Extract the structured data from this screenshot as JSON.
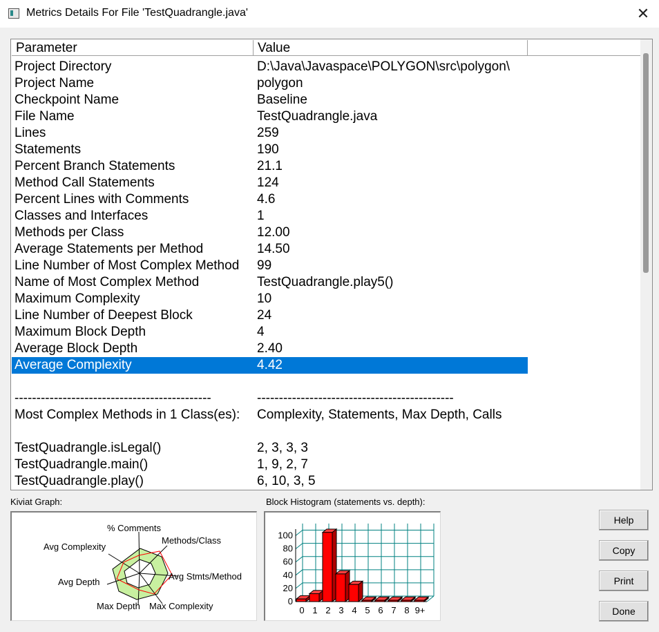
{
  "window": {
    "title": "Metrics Details For File 'TestQuadrangle.java'",
    "close_glyph": "✕"
  },
  "table": {
    "headers": [
      "Parameter",
      "Value"
    ],
    "rows": [
      [
        "Project Directory",
        "D:\\Java\\Javaspace\\POLYGON\\src\\polygon\\"
      ],
      [
        "Project Name",
        "polygon"
      ],
      [
        "Checkpoint Name",
        "Baseline"
      ],
      [
        "File Name",
        "TestQuadrangle.java"
      ],
      [
        "Lines",
        "259"
      ],
      [
        "Statements",
        "190"
      ],
      [
        "Percent Branch Statements",
        "21.1"
      ],
      [
        "Method Call Statements",
        "124"
      ],
      [
        "Percent Lines with Comments",
        "4.6"
      ],
      [
        "Classes and Interfaces",
        "1"
      ],
      [
        "Methods per Class",
        "12.00"
      ],
      [
        "Average Statements per Method",
        "14.50"
      ],
      [
        "Line Number of Most Complex Method",
        "99"
      ],
      [
        "Name of Most Complex Method",
        "TestQuadrangle.play5()"
      ],
      [
        "Maximum Complexity",
        "10"
      ],
      [
        "Line Number of Deepest Block",
        "24"
      ],
      [
        "Maximum Block Depth",
        "4"
      ],
      [
        "Average Block Depth",
        "2.40"
      ],
      [
        "Average Complexity",
        "4.42"
      ],
      [
        "",
        ""
      ],
      [
        "---------------------------------------------",
        "---------------------------------------------"
      ],
      [
        "Most Complex Methods in 1 Class(es):",
        "Complexity, Statements, Max Depth, Calls"
      ],
      [
        "",
        ""
      ],
      [
        "TestQuadrangle.isLegal()",
        "2, 3, 3, 3"
      ],
      [
        "TestQuadrangle.main()",
        "1, 9, 2, 7"
      ],
      [
        "TestQuadrangle.play()",
        "6, 10, 3, 5"
      ]
    ],
    "selected_row": "Average Complexity"
  },
  "kiviat": {
    "label": "Kiviat Graph:",
    "axes": [
      "% Comments",
      "Methods/Class",
      "Avg Stmts/Method",
      "Max Complexity",
      "Max Depth",
      "Avg Depth",
      "Avg Complexity"
    ]
  },
  "histogram": {
    "label": "Block Histogram (statements vs. depth):"
  },
  "chart_data": {
    "type": "bar",
    "categories": [
      "0",
      "1",
      "2",
      "3",
      "4",
      "5",
      "6",
      "7",
      "8",
      "9+"
    ],
    "values": [
      4,
      12,
      105,
      42,
      26,
      2,
      2,
      2,
      2,
      2
    ],
    "yticks": [
      0,
      20,
      40,
      60,
      80,
      100
    ],
    "ylim": [
      0,
      110
    ],
    "grid": true,
    "bar_color": "#ff0000"
  },
  "buttons": {
    "help": "Help",
    "copy": "Copy",
    "print": "Print",
    "done": "Done"
  },
  "colors": {
    "selection": "#0078d7",
    "kiviat_fill": "#c8f0a0",
    "kiviat_line": "#ff0000",
    "histogram_grid": "#008080"
  }
}
